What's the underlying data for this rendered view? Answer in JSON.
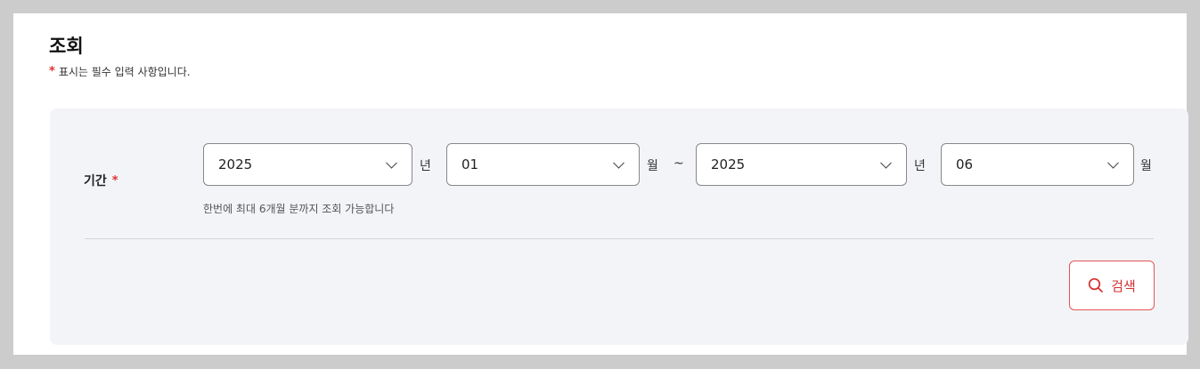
{
  "header": {
    "title": "조회",
    "required_mark": "*",
    "required_note": "표시는 필수 입력 사항입니다."
  },
  "period": {
    "label": "기간",
    "required_mark": "*",
    "start_year": {
      "value": "2025",
      "unit": "년"
    },
    "start_month": {
      "value": "01",
      "unit": "월"
    },
    "separator": "~",
    "end_year": {
      "value": "2025",
      "unit": "년"
    },
    "end_month": {
      "value": "06",
      "unit": "월"
    },
    "hint": "한번에 최대 6개월 분까지 조회 가능합니다"
  },
  "actions": {
    "search_label": "검색"
  },
  "colors": {
    "accent": "#d43030",
    "panel_bg": "#f3f4f8"
  }
}
